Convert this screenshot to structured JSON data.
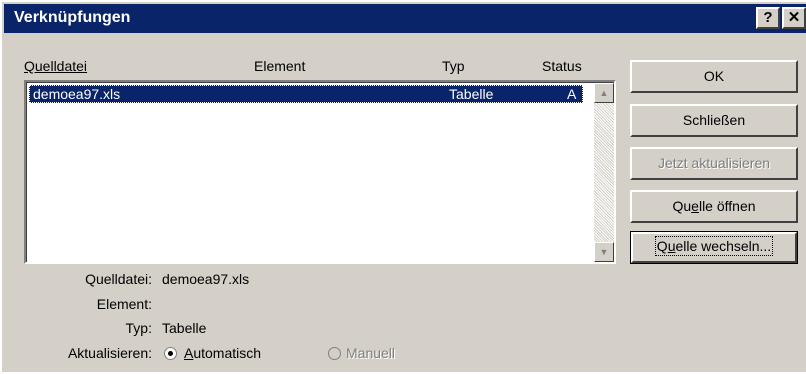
{
  "window": {
    "title": "Verknüpfungen",
    "help_label": "?",
    "close_label": "✕"
  },
  "list": {
    "headers": {
      "source": "Quelldatei",
      "element": "Element",
      "type": "Typ",
      "status": "Status"
    },
    "rows": [
      {
        "source": "demoea97.xls",
        "element": "",
        "type": "Tabelle",
        "status": "A"
      }
    ]
  },
  "buttons": {
    "ok": "OK",
    "close": "Schließen",
    "update_now": "Jetzt aktualisieren",
    "open_source_pre": "Qu",
    "open_source_u": "e",
    "open_source_post": "lle öffnen",
    "change_source_pre": "Q",
    "change_source_u": "u",
    "change_source_post": "elle wechseln..."
  },
  "details": {
    "source_label": "Quelldatei:",
    "source_value": "demoea97.xls",
    "element_label": "Element:",
    "element_value": "",
    "type_label": "Typ:",
    "type_value": "Tabelle",
    "update_label": "Aktualisieren:",
    "auto_u": "A",
    "auto_rest": "utomatisch",
    "manual": "Manuell",
    "selected_mode": "Automatisch"
  },
  "colors": {
    "title_bar": "#0a246a",
    "selection": "#0a246a",
    "face": "#d4d0c8"
  }
}
